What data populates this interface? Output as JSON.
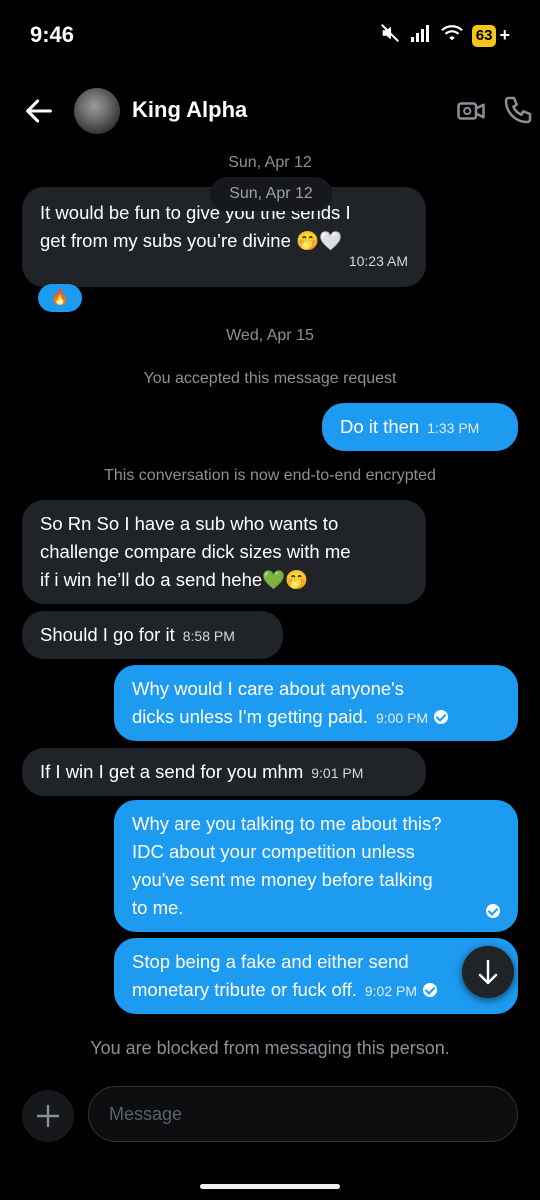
{
  "status_bar": {
    "time": "9:46",
    "battery": "63",
    "battery_suffix": "+"
  },
  "header": {
    "contact_name": "King Alpha"
  },
  "sticky_date": "Sun, Apr 12",
  "date_separators": [
    "Sun, Apr 12",
    "Wed, Apr 15"
  ],
  "system_messages": {
    "accepted": "You accepted this message request",
    "encrypted": "This conversation is now end-to-end encrypted"
  },
  "messages": [
    {
      "side": "received",
      "lines": [
        "It would be fun to give you the sends I",
        "get from my subs you’re divine 🤭🤍"
      ],
      "time": "10:23 AM"
    },
    {
      "side": "sent",
      "lines": [
        "Do it then"
      ],
      "time": "1:33 PM"
    },
    {
      "side": "received",
      "lines": [
        "So Rn So I have a sub who wants to",
        "challenge compare dick sizes with me",
        "if i win he’ll do a send hehe💚🤭"
      ],
      "time": ""
    },
    {
      "side": "received",
      "lines": [
        "Should I go for it"
      ],
      "time": "8:58 PM"
    },
    {
      "side": "sent",
      "lines": [
        "Why would I care about anyone's",
        "dicks unless I'm getting paid."
      ],
      "time": "9:00 PM"
    },
    {
      "side": "received",
      "lines": [
        "If I win I get a send for you mhm"
      ],
      "time": "9:01 PM"
    },
    {
      "side": "sent",
      "lines": [
        "Why are you talking to me about this?",
        "IDC about your competition unless",
        "you've sent me money before talking",
        "to me."
      ],
      "time": ""
    },
    {
      "side": "sent",
      "lines": [
        "Stop being a fake and either send",
        "monetary tribute or fuck off."
      ],
      "time": "9:02 PM"
    }
  ],
  "reaction": "🔥",
  "blocked_notice": "You are blocked from messaging this person.",
  "composer": {
    "placeholder": "Message"
  },
  "colors": {
    "accent": "#1d9bf0",
    "received_bubble": "#202327",
    "background": "#000000"
  }
}
